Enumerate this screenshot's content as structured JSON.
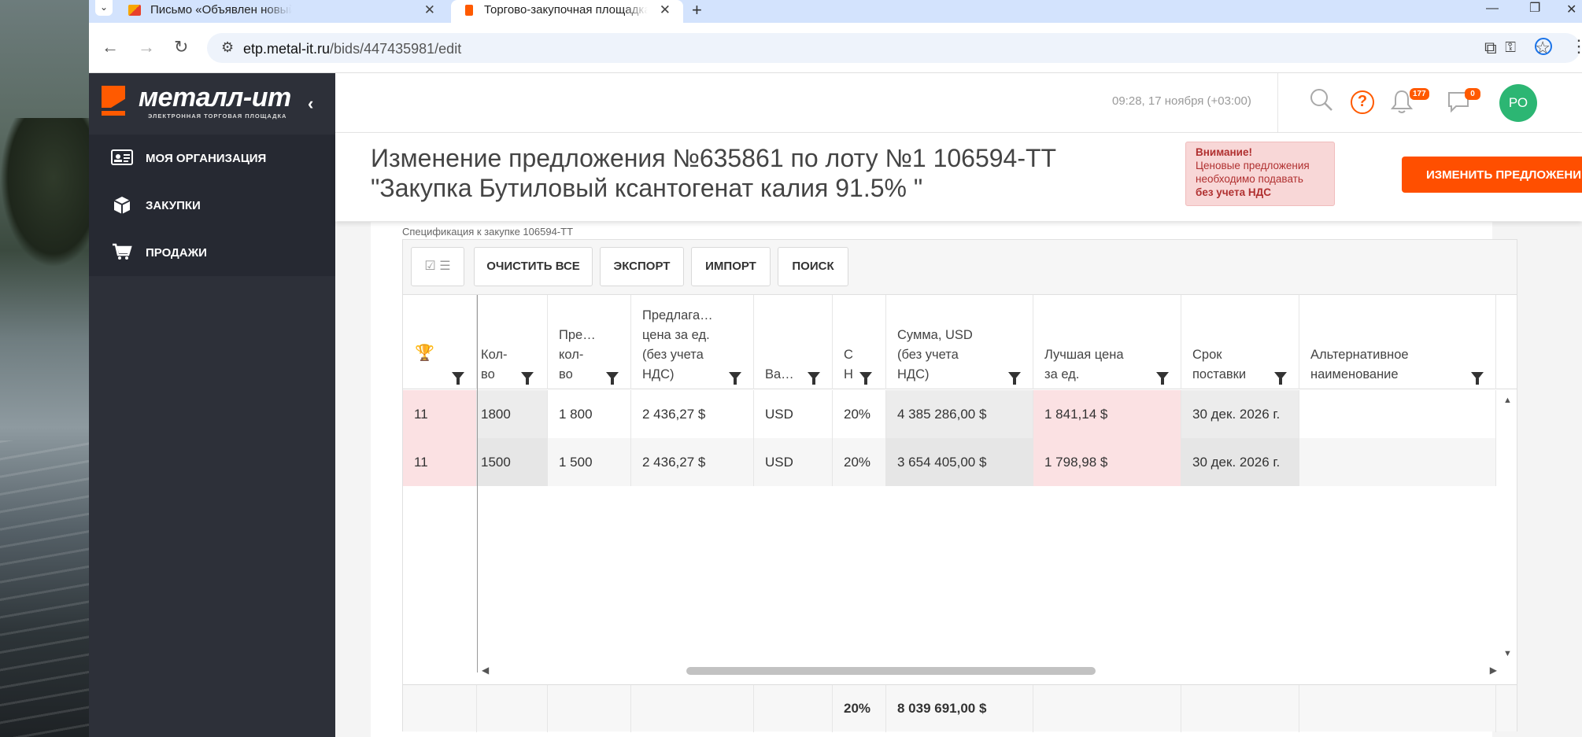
{
  "browser": {
    "tabs": [
      {
        "title": "Письмо «Объявлен новый этап"
      },
      {
        "title": "Торгово-закупочная площадка"
      }
    ],
    "url_host": "etp.metal-it.ru",
    "url_path": "/bids/447435981/edit"
  },
  "sidebar": {
    "logo_name": "металл-ит",
    "logo_sub": "ЭЛЕКТРОННАЯ ТОРГОВАЯ ПЛОЩАДКА",
    "items": [
      {
        "label": "МОЯ ОРГАНИЗАЦИЯ",
        "icon": "id-card-icon"
      },
      {
        "label": "ЗАКУПКИ",
        "icon": "box-icon"
      },
      {
        "label": "ПРОДАЖИ",
        "icon": "cart-icon"
      }
    ]
  },
  "topbar": {
    "datetime": "09:28, 17 ноября (+03:00)",
    "notifications_count": "177",
    "messages_count": "0",
    "avatar_initials": "РО"
  },
  "header": {
    "title_line1": "Изменение предложения №635861 по лоту №1 106594-ТТ",
    "title_line2": "\"Закупка Бутиловый ксантогенат калия 91.5% \"",
    "warning_title": "Внимание!",
    "warning_text": "Ценовые предложения необходимо подавать",
    "warning_bold": "без учета НДС",
    "change_button": "ИЗМЕНИТЬ ПРЕДЛОЖЕНИЕ"
  },
  "spec": {
    "label": "Спецификация к закупке 106594-ТТ",
    "toolbar": {
      "clear_all": "ОЧИСТИТЬ ВСЕ",
      "export": "ЭКСПОРТ",
      "import": "ИМПОРТ",
      "search": "ПОИСК"
    },
    "columns": [
      {
        "label": ""
      },
      {
        "label_lines": [
          "Кол-",
          "во"
        ]
      },
      {
        "label_lines": [
          "Пре…",
          "кол-",
          "во"
        ]
      },
      {
        "label_lines": [
          "Предлага…",
          "цена за ед.",
          "(без учета",
          "НДС)"
        ]
      },
      {
        "label_lines": [
          "Ва…"
        ]
      },
      {
        "label_lines": [
          "С",
          "Н"
        ]
      },
      {
        "label_lines": [
          "Сумма, USD",
          "(без учета",
          "НДС)"
        ]
      },
      {
        "label_lines": [
          "Лучшая цена",
          "за ед."
        ]
      },
      {
        "label_lines": [
          "Срок",
          "поставки"
        ]
      },
      {
        "label_lines": [
          "Альтернативное",
          "наименование"
        ]
      }
    ],
    "rows": [
      {
        "rank": "11",
        "qty": "1800",
        "offered_qty": "1 800",
        "price": "2 436,27 $",
        "currency": "USD",
        "vat": "20%",
        "sum": "4 385 286,00 $",
        "best_price": "1 841,14 $",
        "delivery": "30 дек. 2026 г.",
        "alt_name": ""
      },
      {
        "rank": "11",
        "qty": "1500",
        "offered_qty": "1 500",
        "price": "2 436,27 $",
        "currency": "USD",
        "vat": "20%",
        "sum": "3 654 405,00 $",
        "best_price": "1 798,98 $",
        "delivery": "30 дек. 2026 г.",
        "alt_name": ""
      }
    ],
    "footer": {
      "vat": "20%",
      "total": "8 039 691,00 $"
    }
  }
}
